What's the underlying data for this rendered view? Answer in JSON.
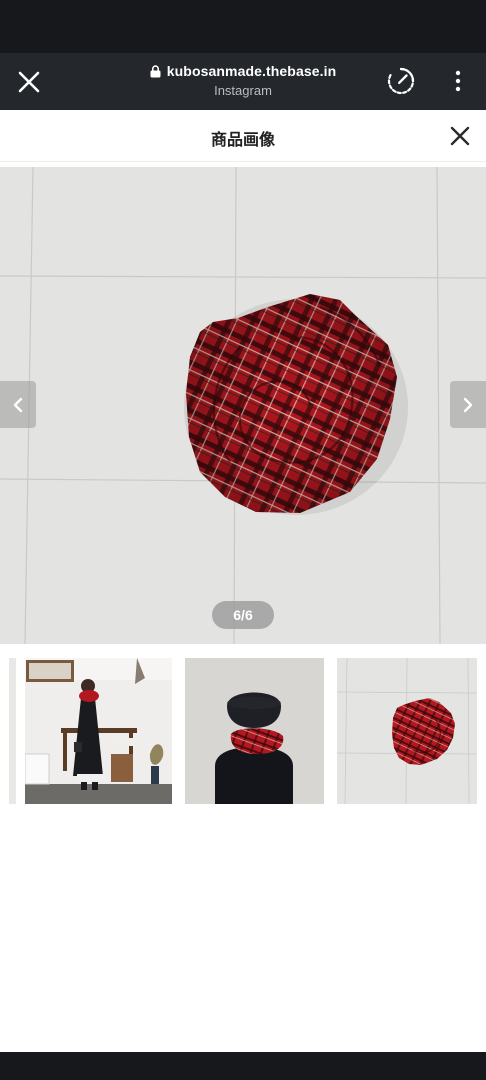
{
  "browser": {
    "url": "kubosanmade.thebase.in",
    "source": "Instagram"
  },
  "header": {
    "title": "商品画像"
  },
  "gallery": {
    "counter": "6/6",
    "current_index": 6,
    "total": 6
  },
  "colors": {
    "browser_bar": "#24272c",
    "status_bar": "#16181c",
    "scarf_red": "#b3171f"
  },
  "icons": {
    "browser_close": "close-icon",
    "lock": "lock-icon",
    "speed": "speedometer-icon",
    "more": "more-vertical-icon",
    "header_close": "close-icon",
    "prev": "chevron-left-icon",
    "next": "chevron-right-icon"
  }
}
